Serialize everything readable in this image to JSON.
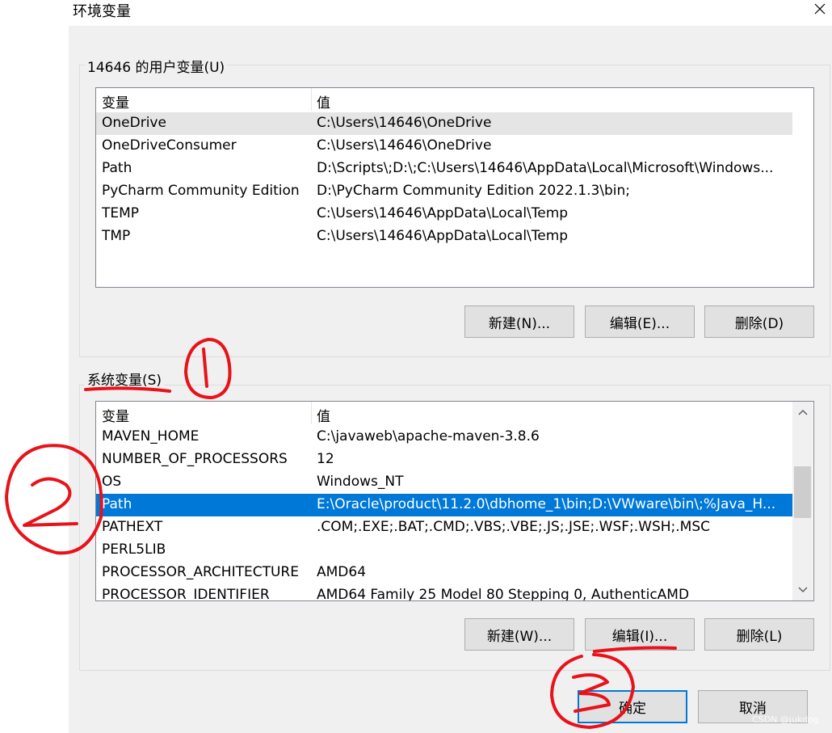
{
  "window": {
    "title": "环境变量"
  },
  "user_vars": {
    "legend": "14646 的用户变量(U)",
    "headers": {
      "var": "变量",
      "val": "值"
    },
    "rows": [
      {
        "name": "OneDrive",
        "value": "C:\\Users\\14646\\OneDrive"
      },
      {
        "name": "OneDriveConsumer",
        "value": "C:\\Users\\14646\\OneDrive"
      },
      {
        "name": "Path",
        "value": "D:\\Scripts\\;D:\\;C:\\Users\\14646\\AppData\\Local\\Microsoft\\Windows..."
      },
      {
        "name": "PyCharm Community Edition",
        "value": "D:\\PyCharm Community Edition 2022.1.3\\bin;"
      },
      {
        "name": "TEMP",
        "value": "C:\\Users\\14646\\AppData\\Local\\Temp"
      },
      {
        "name": "TMP",
        "value": "C:\\Users\\14646\\AppData\\Local\\Temp"
      }
    ],
    "buttons": {
      "new": "新建(N)...",
      "edit": "编辑(E)...",
      "delete": "删除(D)"
    }
  },
  "system_vars": {
    "legend": "系统变量(S)",
    "headers": {
      "var": "变量",
      "val": "值"
    },
    "rows": [
      {
        "name": "MAVEN_HOME",
        "value": "C:\\javaweb\\apache-maven-3.8.6"
      },
      {
        "name": "NUMBER_OF_PROCESSORS",
        "value": "12"
      },
      {
        "name": "OS",
        "value": "Windows_NT"
      },
      {
        "name": "Path",
        "value": "E:\\Oracle\\product\\11.2.0\\dbhome_1\\bin;D:\\VWware\\bin\\;%Java_H..."
      },
      {
        "name": "PATHEXT",
        "value": ".COM;.EXE;.BAT;.CMD;.VBS;.VBE;.JS;.JSE;.WSF;.WSH;.MSC"
      },
      {
        "name": "PERL5LIB",
        "value": ""
      },
      {
        "name": "PROCESSOR_ARCHITECTURE",
        "value": "AMD64"
      },
      {
        "name": "PROCESSOR_IDENTIFIER",
        "value": "AMD64 Family 25 Model 80 Stepping 0, AuthenticAMD"
      }
    ],
    "selected_row": "Path",
    "buttons": {
      "new": "新建(W)...",
      "edit": "编辑(I)...",
      "delete": "删除(L)"
    }
  },
  "footer": {
    "ok": "确定",
    "cancel": "取消"
  },
  "watermark": "CSDN @jukdog",
  "colors": {
    "selection": "#0078d7",
    "hover_row": "#e5e5e5",
    "annotation": "#e8121a"
  }
}
